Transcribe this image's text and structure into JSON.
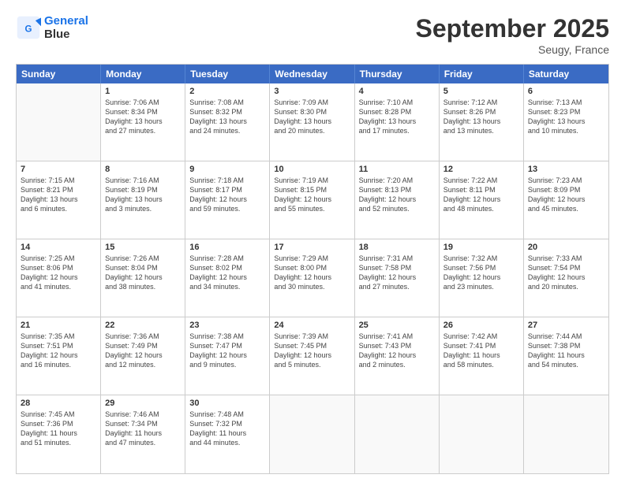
{
  "header": {
    "logo_line1": "General",
    "logo_line2": "Blue",
    "month": "September 2025",
    "location": "Seugy, France"
  },
  "weekdays": [
    "Sunday",
    "Monday",
    "Tuesday",
    "Wednesday",
    "Thursday",
    "Friday",
    "Saturday"
  ],
  "weeks": [
    [
      {
        "day": "",
        "info": ""
      },
      {
        "day": "1",
        "info": "Sunrise: 7:06 AM\nSunset: 8:34 PM\nDaylight: 13 hours\nand 27 minutes."
      },
      {
        "day": "2",
        "info": "Sunrise: 7:08 AM\nSunset: 8:32 PM\nDaylight: 13 hours\nand 24 minutes."
      },
      {
        "day": "3",
        "info": "Sunrise: 7:09 AM\nSunset: 8:30 PM\nDaylight: 13 hours\nand 20 minutes."
      },
      {
        "day": "4",
        "info": "Sunrise: 7:10 AM\nSunset: 8:28 PM\nDaylight: 13 hours\nand 17 minutes."
      },
      {
        "day": "5",
        "info": "Sunrise: 7:12 AM\nSunset: 8:26 PM\nDaylight: 13 hours\nand 13 minutes."
      },
      {
        "day": "6",
        "info": "Sunrise: 7:13 AM\nSunset: 8:23 PM\nDaylight: 13 hours\nand 10 minutes."
      }
    ],
    [
      {
        "day": "7",
        "info": "Sunrise: 7:15 AM\nSunset: 8:21 PM\nDaylight: 13 hours\nand 6 minutes."
      },
      {
        "day": "8",
        "info": "Sunrise: 7:16 AM\nSunset: 8:19 PM\nDaylight: 13 hours\nand 3 minutes."
      },
      {
        "day": "9",
        "info": "Sunrise: 7:18 AM\nSunset: 8:17 PM\nDaylight: 12 hours\nand 59 minutes."
      },
      {
        "day": "10",
        "info": "Sunrise: 7:19 AM\nSunset: 8:15 PM\nDaylight: 12 hours\nand 55 minutes."
      },
      {
        "day": "11",
        "info": "Sunrise: 7:20 AM\nSunset: 8:13 PM\nDaylight: 12 hours\nand 52 minutes."
      },
      {
        "day": "12",
        "info": "Sunrise: 7:22 AM\nSunset: 8:11 PM\nDaylight: 12 hours\nand 48 minutes."
      },
      {
        "day": "13",
        "info": "Sunrise: 7:23 AM\nSunset: 8:09 PM\nDaylight: 12 hours\nand 45 minutes."
      }
    ],
    [
      {
        "day": "14",
        "info": "Sunrise: 7:25 AM\nSunset: 8:06 PM\nDaylight: 12 hours\nand 41 minutes."
      },
      {
        "day": "15",
        "info": "Sunrise: 7:26 AM\nSunset: 8:04 PM\nDaylight: 12 hours\nand 38 minutes."
      },
      {
        "day": "16",
        "info": "Sunrise: 7:28 AM\nSunset: 8:02 PM\nDaylight: 12 hours\nand 34 minutes."
      },
      {
        "day": "17",
        "info": "Sunrise: 7:29 AM\nSunset: 8:00 PM\nDaylight: 12 hours\nand 30 minutes."
      },
      {
        "day": "18",
        "info": "Sunrise: 7:31 AM\nSunset: 7:58 PM\nDaylight: 12 hours\nand 27 minutes."
      },
      {
        "day": "19",
        "info": "Sunrise: 7:32 AM\nSunset: 7:56 PM\nDaylight: 12 hours\nand 23 minutes."
      },
      {
        "day": "20",
        "info": "Sunrise: 7:33 AM\nSunset: 7:54 PM\nDaylight: 12 hours\nand 20 minutes."
      }
    ],
    [
      {
        "day": "21",
        "info": "Sunrise: 7:35 AM\nSunset: 7:51 PM\nDaylight: 12 hours\nand 16 minutes."
      },
      {
        "day": "22",
        "info": "Sunrise: 7:36 AM\nSunset: 7:49 PM\nDaylight: 12 hours\nand 12 minutes."
      },
      {
        "day": "23",
        "info": "Sunrise: 7:38 AM\nSunset: 7:47 PM\nDaylight: 12 hours\nand 9 minutes."
      },
      {
        "day": "24",
        "info": "Sunrise: 7:39 AM\nSunset: 7:45 PM\nDaylight: 12 hours\nand 5 minutes."
      },
      {
        "day": "25",
        "info": "Sunrise: 7:41 AM\nSunset: 7:43 PM\nDaylight: 12 hours\nand 2 minutes."
      },
      {
        "day": "26",
        "info": "Sunrise: 7:42 AM\nSunset: 7:41 PM\nDaylight: 11 hours\nand 58 minutes."
      },
      {
        "day": "27",
        "info": "Sunrise: 7:44 AM\nSunset: 7:38 PM\nDaylight: 11 hours\nand 54 minutes."
      }
    ],
    [
      {
        "day": "28",
        "info": "Sunrise: 7:45 AM\nSunset: 7:36 PM\nDaylight: 11 hours\nand 51 minutes."
      },
      {
        "day": "29",
        "info": "Sunrise: 7:46 AM\nSunset: 7:34 PM\nDaylight: 11 hours\nand 47 minutes."
      },
      {
        "day": "30",
        "info": "Sunrise: 7:48 AM\nSunset: 7:32 PM\nDaylight: 11 hours\nand 44 minutes."
      },
      {
        "day": "",
        "info": ""
      },
      {
        "day": "",
        "info": ""
      },
      {
        "day": "",
        "info": ""
      },
      {
        "day": "",
        "info": ""
      }
    ]
  ]
}
